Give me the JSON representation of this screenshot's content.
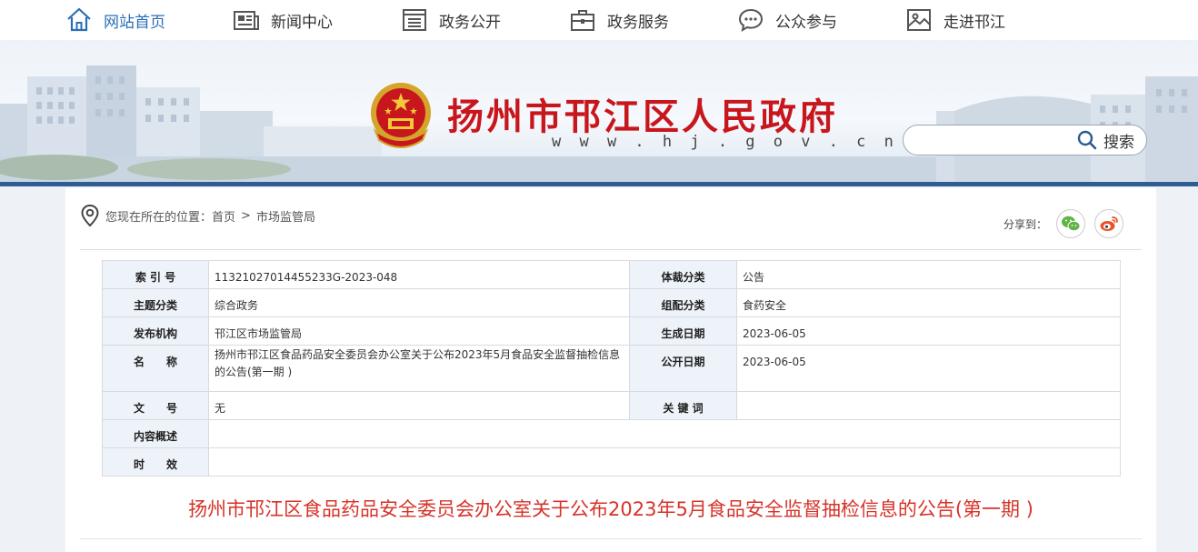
{
  "nav": [
    {
      "label": "网站首页",
      "icon": "home-icon"
    },
    {
      "label": "新闻中心",
      "icon": "news-icon"
    },
    {
      "label": "政务公开",
      "icon": "document-list-icon"
    },
    {
      "label": "政务服务",
      "icon": "briefcase-icon"
    },
    {
      "label": "公众参与",
      "icon": "chat-icon"
    },
    {
      "label": "走进邗江",
      "icon": "picture-icon"
    }
  ],
  "header": {
    "title": "扬州市邗江区人民政府",
    "url": "w w w . h j . g o v . c n",
    "search_placeholder": "",
    "search_label": "搜索"
  },
  "breadcrumb": {
    "prefix": "您现在所在的位置：",
    "home": "首页",
    "separator": ">",
    "current": "市场监管局"
  },
  "share": {
    "label": "分享到："
  },
  "info": {
    "index_label": "索 引 号",
    "index_value": "11321027014455233G-2023-048",
    "genre_label": "体裁分类",
    "genre_value": "公告",
    "theme_label": "主题分类",
    "theme_value": "综合政务",
    "category_label": "组配分类",
    "category_value": "食药安全",
    "publisher_label": "发布机构",
    "publisher_value": "邗江区市场监管局",
    "created_label": "生成日期",
    "created_value": "2023-06-05",
    "name_label": "名　　称",
    "name_value": "扬州市邗江区食品药品安全委员会办公室关于公布2023年5月食品安全监督抽检信息的公告(第一期 )",
    "published_label": "公开日期",
    "published_value": "2023-06-05",
    "docno_label": "文　　号",
    "docno_value": "无",
    "keywords_label": "关 键 词",
    "keywords_value": "",
    "summary_label": "内容概述",
    "summary_value": "",
    "validity_label": "时　　效",
    "validity_value": ""
  },
  "article": {
    "title": "扬州市邗江区食品药品安全委员会办公室关于公布2023年5月食品安全监督抽检信息的公告(第一期 )"
  },
  "colors": {
    "accent_blue": "#2a6fb5",
    "title_red": "#c8161d",
    "article_red": "#d6332a",
    "banner_bar": "#2f5d93",
    "wechat_green": "#5fb446",
    "weibo_orange": "#e8542a"
  }
}
